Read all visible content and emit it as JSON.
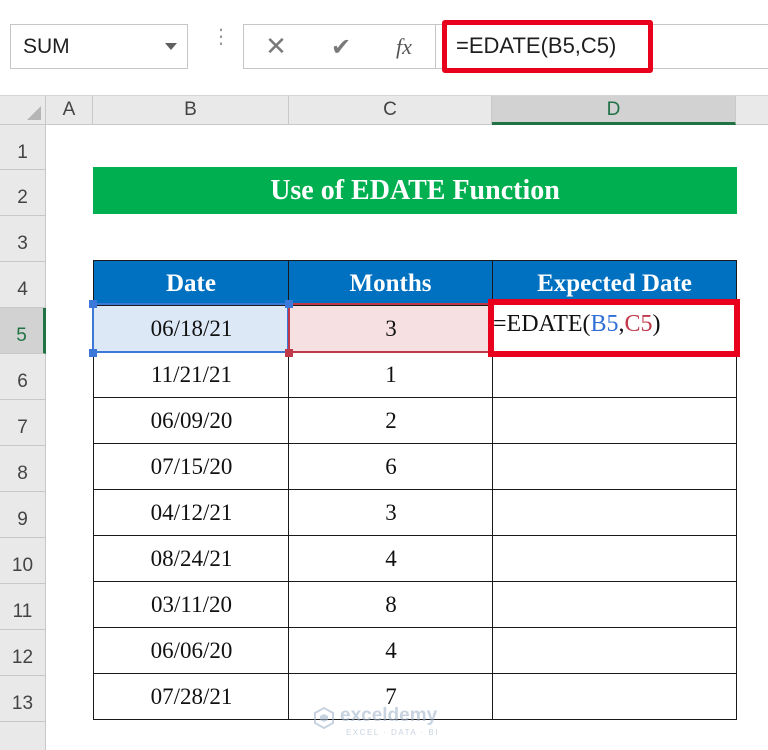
{
  "formula_bar": {
    "name_box": "SUM",
    "cancel_icon": "close-icon",
    "enter_icon": "check-icon",
    "fx_label": "fx",
    "formula": "=EDATE(B5,C5)"
  },
  "columns": [
    "A",
    "B",
    "C",
    "D"
  ],
  "rows": [
    "1",
    "2",
    "3",
    "4",
    "5",
    "6",
    "7",
    "8",
    "9",
    "10",
    "11",
    "12",
    "13"
  ],
  "active_cell": "D5",
  "sheet": {
    "title": "Use of EDATE Function",
    "headers": [
      "Date",
      "Months",
      "Expected Date"
    ],
    "data": [
      {
        "date": "06/18/21",
        "months": "3",
        "expected": ""
      },
      {
        "date": "11/21/21",
        "months": "1",
        "expected": ""
      },
      {
        "date": "06/09/20",
        "months": "2",
        "expected": ""
      },
      {
        "date": "07/15/20",
        "months": "6",
        "expected": ""
      },
      {
        "date": "04/12/21",
        "months": "3",
        "expected": ""
      },
      {
        "date": "08/24/21",
        "months": "4",
        "expected": ""
      },
      {
        "date": "03/11/20",
        "months": "8",
        "expected": ""
      },
      {
        "date": "06/06/20",
        "months": "4",
        "expected": ""
      },
      {
        "date": "07/28/21",
        "months": "7",
        "expected": ""
      }
    ],
    "edit_formula": {
      "prefix": "=EDATE(",
      "ref1": "B5",
      "sep": ",",
      "ref2": "C5",
      "suffix": ")"
    }
  },
  "watermark": {
    "name": "exceldemy",
    "tagline": "EXCEL · DATA · BI"
  },
  "colors": {
    "title_bg": "#00b050",
    "header_bg": "#0070c0",
    "highlight": "#e8001c",
    "ref_b": "#2f6fd6",
    "ref_c": "#c0394b"
  }
}
